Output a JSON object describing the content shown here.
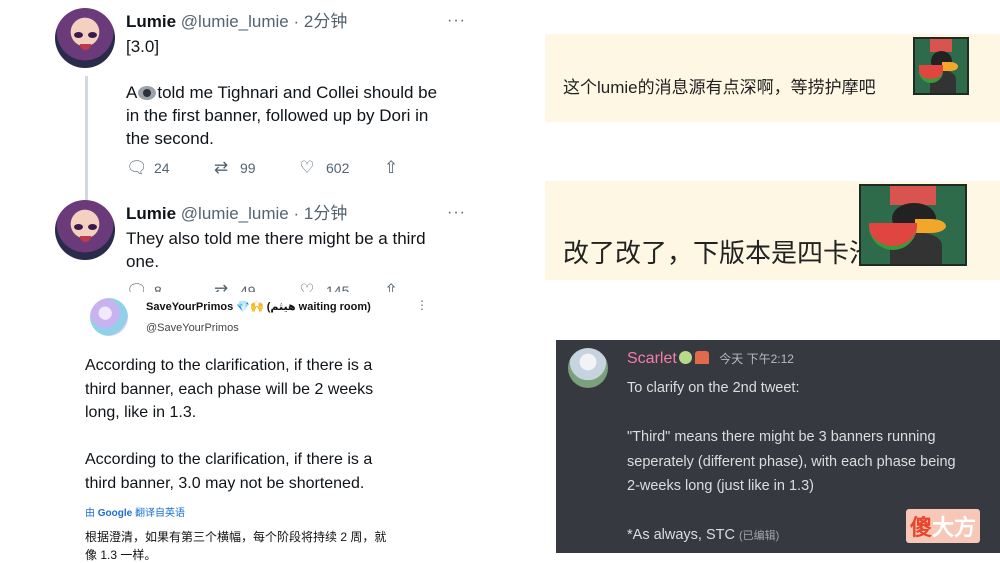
{
  "tweets": [
    {
      "name": "Lumie",
      "handle": "@lumie_lumie",
      "time": "· 2分钟",
      "more": "···",
      "line1": "[3.0]",
      "line2_pre": "A",
      "line2_post": "told me Tighnari and Collei should be",
      "line3": "in the first banner, followed up by Dori in",
      "line4": "the second.",
      "replies": "24",
      "retweets": "99",
      "likes": "602"
    },
    {
      "name": "Lumie",
      "handle": "@lumie_lumie",
      "time": "· 1分钟",
      "more": "···",
      "line1": "They also told me there might be a third",
      "line2": "one.",
      "replies": "8",
      "retweets": "49",
      "likes": "145"
    }
  ],
  "primos": {
    "name": "SaveYourPrimos 💎🙌 (هيثم waiting room)",
    "handle": "@SaveYourPrimos",
    "more": "⋮",
    "p1": [
      "According to the clarification, if there is a",
      "third banner, each phase will be 2 weeks",
      "long, like in 1.3."
    ],
    "p2": [
      "According to the clarification, if there is a",
      "third banner, 3.0 may not be shortened."
    ],
    "translate_pre": "由",
    "translate_brand": "Google",
    "translate_post": "翻译自英语",
    "translation": [
      "根据澄清，如果有第三个横幅，每个阶段将持续 2 周，就",
      "像 1.3 一样。"
    ]
  },
  "chat": {
    "bubble1": "这个lumie的消息源有点深啊，等捞护摩吧",
    "bubble2": "改了改了，下版本是四卡池"
  },
  "discord": {
    "name": "Scarlet",
    "time": "今天 下午2:12",
    "line1": "To clarify on the 2nd tweet:",
    "quote": [
      "\"Third\" means there might be 3 banners running",
      "seperately (different phase), with each phase being",
      "2-weeks long (just like in 1.3)"
    ],
    "footer": "*As always, STC",
    "edited": "(已编辑)"
  },
  "watermark": {
    "first": "傻",
    "rest": "大方"
  }
}
